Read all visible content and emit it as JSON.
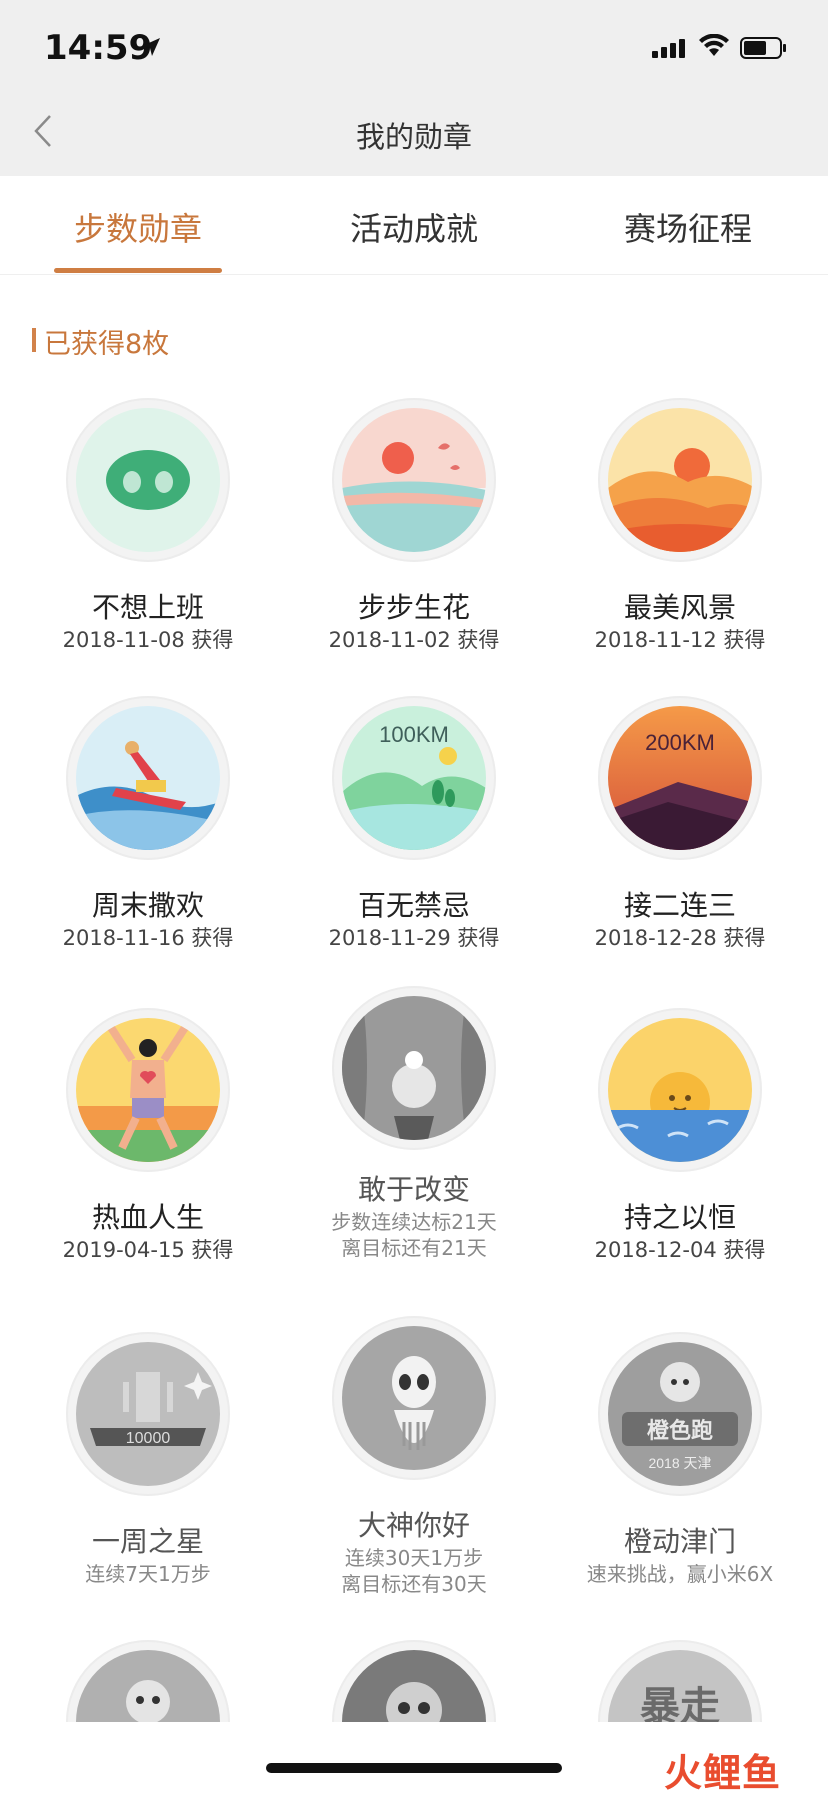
{
  "status_bar": {
    "time": "14:59"
  },
  "nav": {
    "title": "我的勋章"
  },
  "tabs": [
    {
      "label": "步数勋章",
      "active": true
    },
    {
      "label": "活动成就",
      "active": false
    },
    {
      "label": "赛场征程",
      "active": false
    }
  ],
  "section": {
    "title": "已获得8枚"
  },
  "medals": [
    {
      "name": "不想上班",
      "line1": "2018-11-08 获得"
    },
    {
      "name": "步步生花",
      "line1": "2018-11-02 获得"
    },
    {
      "name": "最美风景",
      "line1": "2018-11-12 获得"
    },
    {
      "name": "周末撒欢",
      "line1": "2018-11-16 获得"
    },
    {
      "name": "百无禁忌",
      "line1": "2018-11-29 获得",
      "badge_text": "100KM"
    },
    {
      "name": "接二连三",
      "line1": "2018-12-28 获得",
      "badge_text": "200KM"
    },
    {
      "name": "热血人生",
      "line1": "2019-04-15 获得"
    },
    {
      "name": "敢于改变",
      "line1": "步数连续达标21天",
      "line2": "离目标还有21天"
    },
    {
      "name": "持之以恒",
      "line1": "2018-12-04 获得"
    },
    {
      "name": "一周之星",
      "line1": "连续7天1万步",
      "badge_text": "10000"
    },
    {
      "name": "大神你好",
      "line1": "连续30天1万步",
      "line2": "离目标还有30天"
    },
    {
      "name": "橙动津门",
      "line1": "速来挑战，赢小米6X",
      "badge_text": "橙色跑",
      "badge_sub": "2018 天津"
    }
  ],
  "partial_badges": [
    {
      "badge_text": ""
    },
    {
      "badge_text": ""
    },
    {
      "badge_text": "暴走"
    }
  ],
  "watermark": {
    "text": "火鲤鱼"
  },
  "colors": {
    "accent": "#c8773c",
    "topbar_bg": "#efefef"
  }
}
